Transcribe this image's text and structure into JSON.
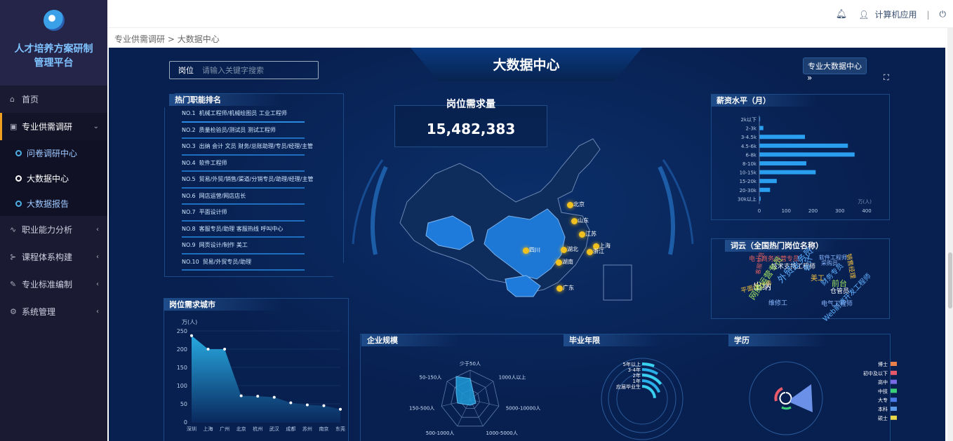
{
  "sidebar": {
    "title": "人才培养方案研制管理平台",
    "title_line1": "人才培养方案研制",
    "title_line2": "管理平台",
    "items": [
      {
        "label": "首页",
        "icon": "home-icon"
      },
      {
        "label": "专业供需调研",
        "icon": "briefcase-icon",
        "open": true
      },
      {
        "label": "职业能力分析",
        "icon": "chart-line-icon"
      },
      {
        "label": "课程体系构建",
        "icon": "tree-icon"
      },
      {
        "label": "专业标准编制",
        "icon": "edit-icon"
      },
      {
        "label": "系统管理",
        "icon": "gear-icon"
      }
    ],
    "subitems": [
      {
        "label": "问卷调研中心",
        "active": false
      },
      {
        "label": "大数据中心",
        "active": true
      },
      {
        "label": "大数据报告",
        "active": false
      }
    ]
  },
  "topbar": {
    "user": "计算机应用",
    "separator": "|"
  },
  "breadcrumb": {
    "parent": "专业供需调研",
    "sep": ">",
    "current": "大数据中心"
  },
  "dashboard": {
    "title": "大数据中心",
    "search_label": "岗位",
    "search_placeholder": "请输入关键字搜索",
    "button": "专业大数据中心",
    "expand_glyph": "»",
    "demand_title": "岗位需求量",
    "demand_value": "15,482,383"
  },
  "ranking": {
    "title": "热门职能排名",
    "items": [
      {
        "no": "NO.1",
        "text": "机械工程师/机械绘图员 工业工程师"
      },
      {
        "no": "NO.2",
        "text": "质量检验员/测试员 测试工程师"
      },
      {
        "no": "NO.3",
        "text": "出纳 会计 文员 财务/总账助理/专员/经理/主管"
      },
      {
        "no": "NO.4",
        "text": "软件工程师"
      },
      {
        "no": "NO.5",
        "text": "贸易/外贸/销售/渠道/分销专员/助理/经理/主管"
      },
      {
        "no": "NO.6",
        "text": "网店运营/网店店长"
      },
      {
        "no": "NO.7",
        "text": "平面设计师"
      },
      {
        "no": "NO.8",
        "text": "客服专员/助理 客服热线 呼叫中心"
      },
      {
        "no": "NO.9",
        "text": "网页设计/制作 美工"
      },
      {
        "no": "NO.10",
        "text": "贸易/外贸专员/助理"
      }
    ]
  },
  "map": {
    "cities": [
      {
        "name": "北京",
        "color": "#f0c020"
      },
      {
        "name": "山东",
        "color": "#f0c020"
      },
      {
        "name": "江苏",
        "color": "#f0c020"
      },
      {
        "name": "上海",
        "color": "#f0c020"
      },
      {
        "name": "浙江",
        "color": "#f0c020"
      },
      {
        "name": "湖北",
        "color": "#f0c020"
      },
      {
        "name": "湖南",
        "color": "#f0c020"
      },
      {
        "name": "四川",
        "color": "#f0c020"
      },
      {
        "name": "广东",
        "color": "#f0c020"
      }
    ]
  },
  "salary": {
    "title": "薪资水平（月）",
    "unit": "万(人)",
    "chart_data": {
      "type": "bar",
      "categories": [
        "2k以下",
        "2-3k",
        "3-4.5k",
        "4.5-6k",
        "6-8k",
        "8-10k",
        "10-15k",
        "15-20k",
        "20-30k",
        "30k以上"
      ],
      "values": [
        3,
        15,
        170,
        330,
        355,
        175,
        210,
        65,
        40,
        5
      ],
      "xlim": [
        0,
        400
      ],
      "xticks": [
        "0",
        "100",
        "200",
        "300",
        "400"
      ]
    }
  },
  "wordcloud": {
    "title": "词云（全国热门岗位名称）",
    "words": [
      {
        "t": "电子商务运营专员",
        "c": "#e06060"
      },
      {
        "t": "软件工程师",
        "c": "#8ab8ff"
      },
      {
        "t": "技术支持工程师",
        "c": "#ffffff"
      },
      {
        "t": "前台",
        "c": "#a0e060"
      },
      {
        "t": "会计",
        "c": "#5fb0ff"
      },
      {
        "t": "外贸业务员",
        "c": "#5fb0ff"
      },
      {
        "t": "美工",
        "c": "#f0c040"
      },
      {
        "t": "财务专员",
        "c": "#5fb0ff"
      },
      {
        "t": "出纳",
        "c": "#ffffff"
      },
      {
        "t": "平面设计师",
        "c": "#f0c040"
      },
      {
        "t": "Web前端开发工程师",
        "c": "#5fb0ff"
      },
      {
        "t": "电气工程师",
        "c": "#8ab8ff"
      },
      {
        "t": "维修工",
        "c": "#8ab8ff"
      },
      {
        "t": "仓管员",
        "c": "#ffffff"
      },
      {
        "t": "客服专员",
        "c": "#e06060"
      },
      {
        "t": "网络运营专员",
        "c": "#a0e060"
      },
      {
        "t": "销售经理",
        "c": "#f0c040"
      },
      {
        "t": "采购员",
        "c": "#8ab8ff"
      }
    ]
  },
  "city": {
    "title": "岗位需求城市",
    "unit": "万(人)",
    "chart_data": {
      "type": "area",
      "categories": [
        "深圳",
        "上海",
        "广州",
        "北京",
        "杭州",
        "武汉",
        "成都",
        "苏州",
        "南京",
        "东莞"
      ],
      "values": [
        237,
        200,
        200,
        72,
        71,
        68,
        53,
        47,
        45,
        35
      ],
      "ylim": [
        0,
        250
      ],
      "yticks": [
        "0",
        "50",
        "100",
        "150",
        "200",
        "250"
      ]
    }
  },
  "enterprise": {
    "title": "企业规模",
    "chart_data": {
      "type": "radar",
      "axes": [
        "少于50人",
        "1000人以上",
        "5000-10000人",
        "1000-5000人",
        "500-1000人",
        "150-500人",
        "50-150人"
      ]
    }
  },
  "years": {
    "title": "毕业年限",
    "chart_data": {
      "type": "bar",
      "categories": [
        "5年以上",
        "3-4年",
        "2年",
        "1年",
        "应届毕业生"
      ]
    }
  },
  "edu": {
    "title": "学历",
    "chart_data": {
      "type": "pie",
      "categories": [
        "博士",
        "初中及以下",
        "高中",
        "中技",
        "大专",
        "本科",
        "硕士"
      ],
      "colors": [
        "#e8804a",
        "#e85a6a",
        "#7a6ae8",
        "#3ad07a",
        "#4a7ae8",
        "#5a9ae8",
        "#e8d84a"
      ]
    }
  }
}
